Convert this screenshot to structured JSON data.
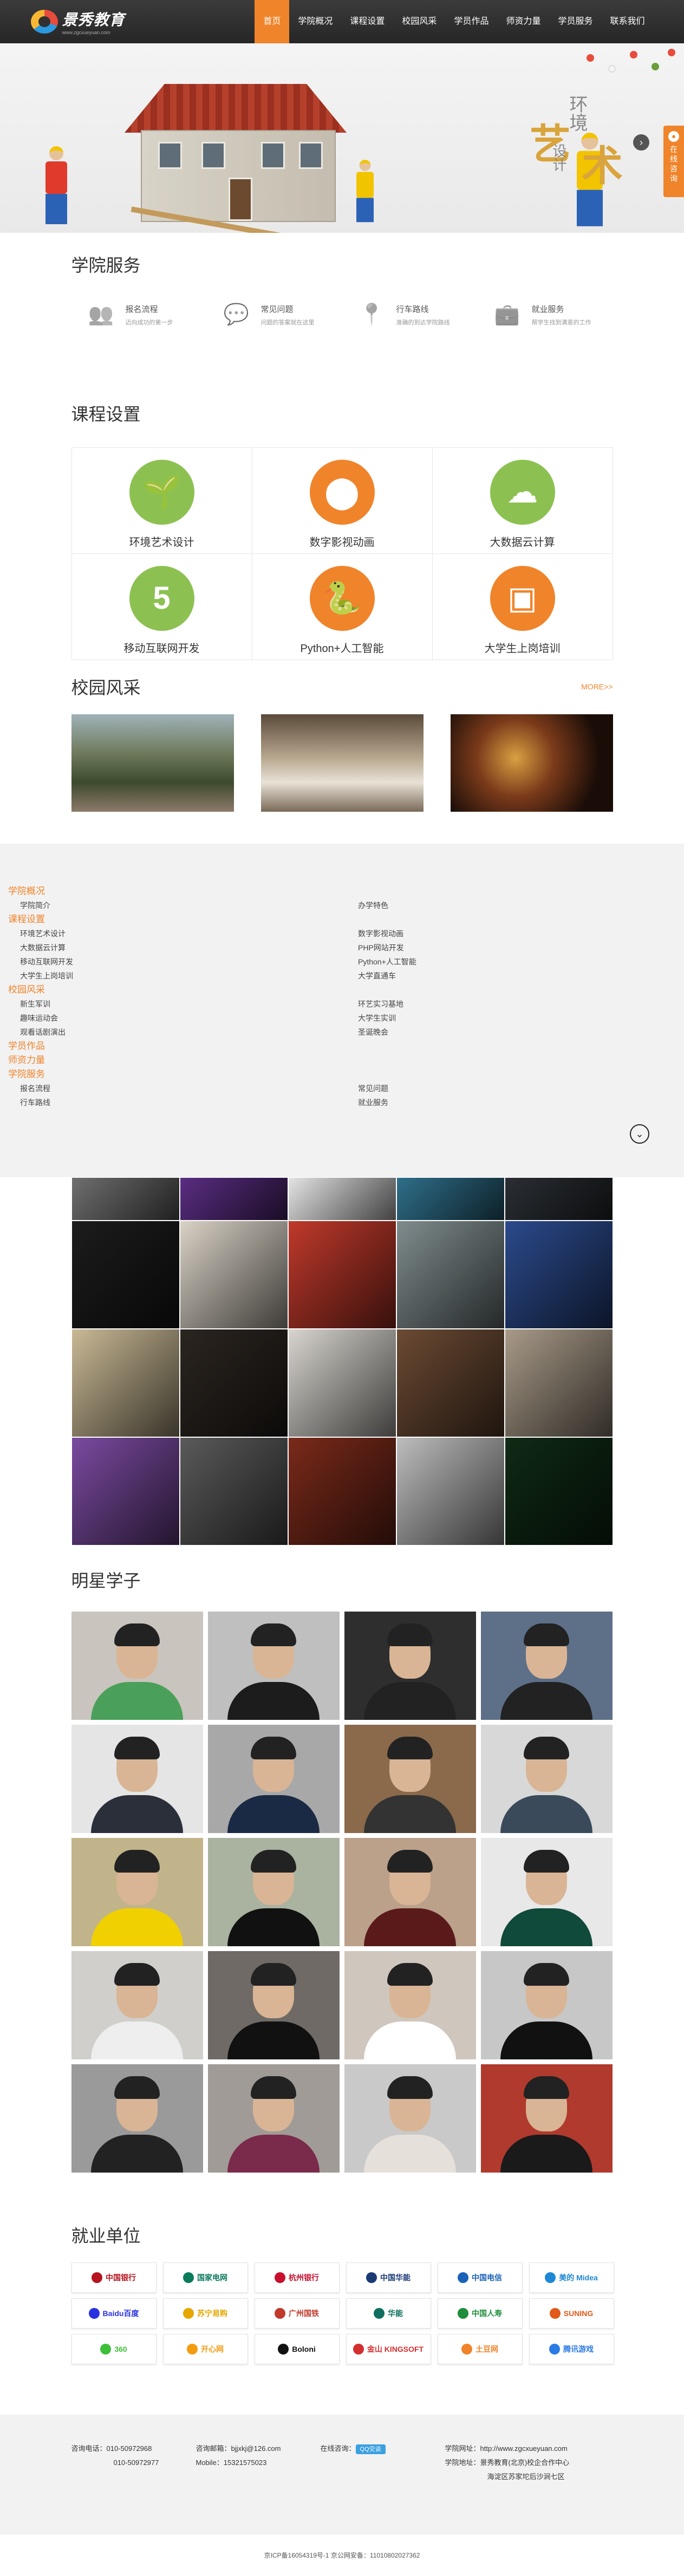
{
  "header": {
    "logo_text": "景秀教育",
    "logo_sub": "www.zgcxueyuan.com",
    "nav": [
      "首页",
      "学院概况",
      "课程设置",
      "校园风采",
      "学员作品",
      "师资力量",
      "学员服务",
      "联系我们"
    ],
    "active_nav": "首页"
  },
  "banner": {
    "art_char": "艺",
    "env_text": "环境",
    "design_text": "设计",
    "shu_char": "术",
    "next_arrow": "›"
  },
  "float_consult": {
    "label": "在线咨询",
    "icon": "chat-icon"
  },
  "services": {
    "title": "学院服务",
    "items": [
      {
        "name": "报名流程",
        "desc": "迈向成功的第一步",
        "icon": "users-icon"
      },
      {
        "name": "常见问题",
        "desc": "问题的答案就在这里",
        "icon": "question-icon"
      },
      {
        "name": "行车路线",
        "desc": "准确的到达学院路线",
        "icon": "map-pin-icon"
      },
      {
        "name": "就业服务",
        "desc": "帮学生找到满意的工作",
        "icon": "briefcase-icon"
      }
    ]
  },
  "courses": {
    "title": "课程设置",
    "items": [
      {
        "name": "环境艺术设计",
        "color": "#8cc152",
        "glyph": "🌱"
      },
      {
        "name": "数字影视动画",
        "color": "#f0842a",
        "glyph": "⬤"
      },
      {
        "name": "大数据云计算",
        "color": "#8cc152",
        "glyph": "☁"
      },
      {
        "name": "移动互联网开发",
        "color": "#8cc152",
        "glyph": "5"
      },
      {
        "name": "Python+人工智能",
        "color": "#f0842a",
        "glyph": "🐍"
      },
      {
        "name": "大学生上岗培训",
        "color": "#f0842a",
        "glyph": "▣"
      }
    ]
  },
  "campus": {
    "title": "校园风采",
    "more": "MORE>>"
  },
  "sitemap": {
    "left": [
      {
        "cat": "学院概况",
        "items": [
          "学院简介"
        ]
      },
      {
        "cat": "课程设置",
        "items": [
          "环境艺术设计",
          "大数据云计算",
          "移动互联网开发",
          "大学生上岗培训"
        ]
      },
      {
        "cat": "校园风采",
        "items": [
          "新生军训",
          "趣味运动会",
          "观看话剧演出"
        ]
      },
      {
        "cat": "学员作品",
        "items": []
      },
      {
        "cat": "师资力量",
        "items": []
      },
      {
        "cat": "学院服务",
        "items": [
          "报名流程",
          "行车路线"
        ]
      }
    ],
    "right": [
      {
        "items": [
          "办学特色"
        ]
      },
      {
        "items": [
          "数字影视动画",
          "PHP网站开发",
          "Python+人工智能",
          "大学直通车"
        ]
      },
      {
        "items": [
          "环艺实习基地",
          "大学生实训",
          "圣诞晚会"
        ]
      },
      {
        "items": [
          "常见问题",
          "就业服务"
        ]
      }
    ],
    "toggle": "⌄"
  },
  "students": {
    "title": "明星学子"
  },
  "employers": {
    "title": "就业单位",
    "logos": [
      {
        "name": "中国银行",
        "color": "#b5141e"
      },
      {
        "name": "国家电网",
        "color": "#0a7a5c"
      },
      {
        "name": "杭州银行",
        "color": "#c8102e"
      },
      {
        "name": "中国华能",
        "color": "#1b3a75"
      },
      {
        "name": "中国电信",
        "color": "#1a62b8"
      },
      {
        "name": "美的 Midea",
        "color": "#1e88d6"
      },
      {
        "name": "Baidu百度",
        "color": "#2932e1"
      },
      {
        "name": "苏宁易购",
        "color": "#e6a700"
      },
      {
        "name": "广州国铁",
        "color": "#c0392b"
      },
      {
        "name": "华能",
        "color": "#0f6f5e"
      },
      {
        "name": "中国人寿",
        "color": "#1e8c3a"
      },
      {
        "name": "SUNING",
        "color": "#e05a1a"
      },
      {
        "name": "360",
        "color": "#3dbf3a"
      },
      {
        "name": "开心网",
        "color": "#f39c12"
      },
      {
        "name": "Boloni",
        "color": "#111111"
      },
      {
        "name": "金山 KINGSOFT",
        "color": "#d32f2f"
      },
      {
        "name": "土豆网",
        "color": "#f0842a"
      },
      {
        "name": "腾讯游戏",
        "color": "#2a7be4"
      }
    ]
  },
  "footer": {
    "phone_label": "咨询电话：",
    "phone1": "010-50972968",
    "phone2": "010-50972977",
    "email_label": "咨询邮箱：",
    "email": "bjjxkj@126.com",
    "mobile_label": "Mobile：",
    "mobile": "15321575023",
    "online_label": "在线咨询：",
    "qq_btn": "QQ交谈",
    "site_label": "学院网址：",
    "site": "http://www.zgcxueyuan.com",
    "addr_label": "学院地址：",
    "addr1": "景秀教育(北京)校企合作中心",
    "addr2": "海淀区苏家坨后沙涧七区",
    "copyright": "京ICP备16054319号-1     京公网安备：11010802027362"
  }
}
